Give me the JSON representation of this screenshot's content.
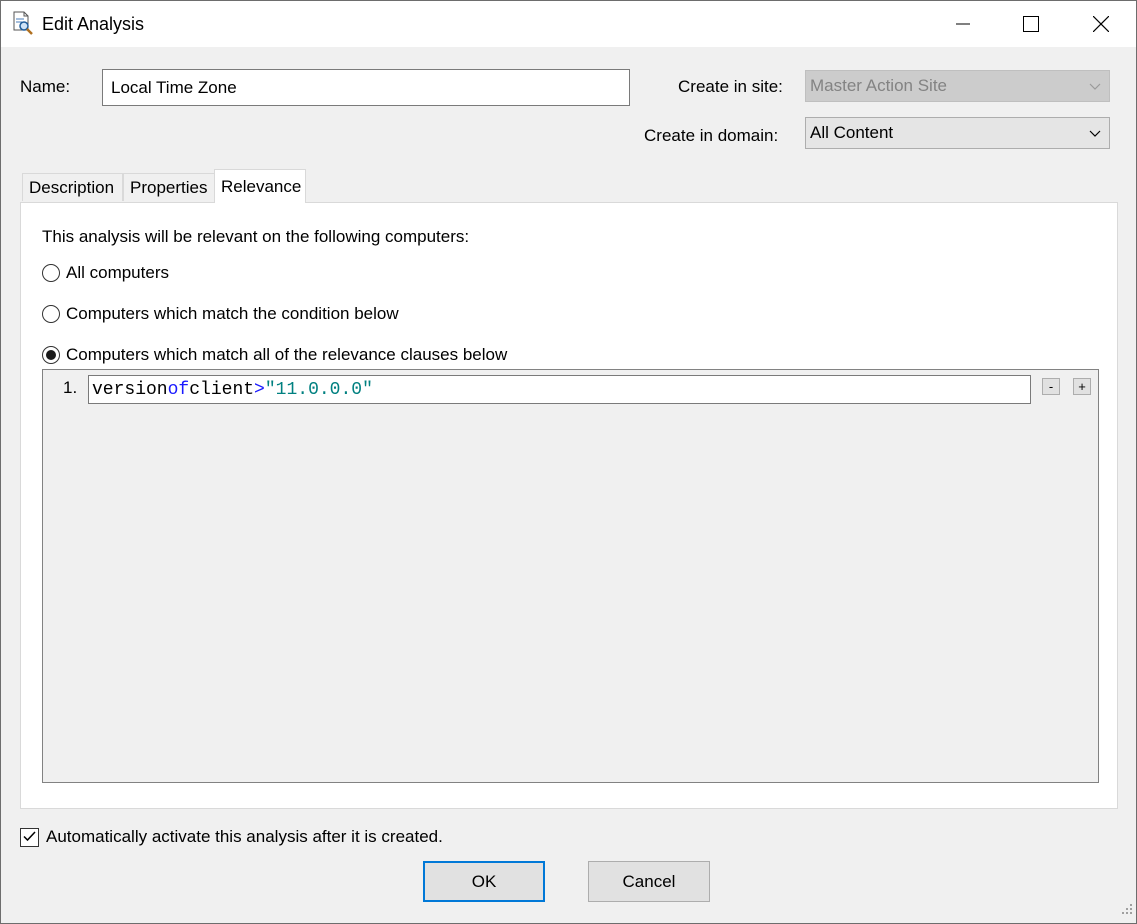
{
  "window": {
    "title": "Edit Analysis",
    "icons": {
      "app": "document-search-icon",
      "minimize": "minimize-icon",
      "maximize": "maximize-icon",
      "close": "close-icon"
    }
  },
  "form": {
    "name_label": "Name:",
    "name_value": "Local Time Zone",
    "site_label": "Create in site:",
    "site_value": "Master Action Site",
    "domain_label": "Create in domain:",
    "domain_value": "All Content"
  },
  "tabs": [
    {
      "label": "Description",
      "active": false
    },
    {
      "label": "Properties",
      "active": false
    },
    {
      "label": "Relevance",
      "active": true
    }
  ],
  "relevance": {
    "intro": "This analysis will be relevant on the following computers:",
    "options": [
      {
        "label": "All computers",
        "selected": false
      },
      {
        "label": "Computers which match the condition below",
        "selected": false
      },
      {
        "label": "Computers which match all of the relevance clauses below",
        "selected": true
      }
    ],
    "clauses": [
      {
        "number": "1.",
        "tokens": {
          "t1": "version",
          "t2": "of",
          "t3": "client",
          "t4": ">",
          "t5": "\"11.0.0.0\""
        }
      }
    ],
    "remove_label": "-",
    "add_label": "+"
  },
  "auto_activate": {
    "label": "Automatically activate this analysis after it is created.",
    "checked": true
  },
  "buttons": {
    "ok": "OK",
    "cancel": "Cancel"
  },
  "colors": {
    "keyword": "#1a1aff",
    "string": "#008080",
    "accent": "#0078d7"
  }
}
